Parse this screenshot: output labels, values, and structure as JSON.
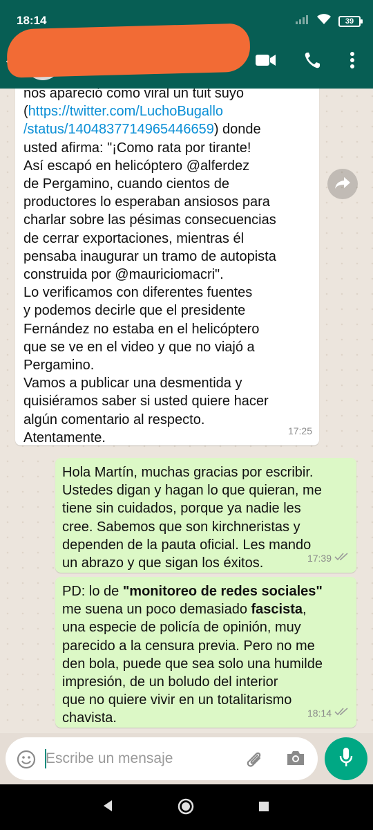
{
  "status_bar": {
    "time": "18:14",
    "battery": "39",
    "icons": [
      "signal-icon",
      "wifi-icon",
      "battery-icon"
    ]
  },
  "app_bar": {
    "contact_name": "",
    "actions": [
      "video-call-icon",
      "phone-icon",
      "more-options-icon"
    ],
    "colors": {
      "bar": "#075e54"
    }
  },
  "messages": [
    {
      "direction": "incoming",
      "time": "17:25",
      "lines": [
        "nos apareció como viral un tuit suyo",
        "(https://twitter.com/LuchoBugallo",
        "/status/1404837714965446659) donde",
        "usted afirma: \"¡Como rata por tirante!",
        "Así escapó en helicóptero @alferdez",
        "de Pergamino, cuando cientos de",
        "productores lo esperaban ansiosos para",
        "charlar sobre las pésimas consecuencias",
        "de cerrar exportaciones, mientras él",
        "pensaba inaugurar un tramo de autopista",
        "construida por @mauriciomacri\".",
        "Lo verificamos con diferentes fuentes",
        "y podemos decirle que el presidente",
        "Fernández no estaba en el helicóptero",
        "que se ve en el video y que no viajó a",
        "Pergamino.",
        "Vamos a publicar una desmentida y",
        "quisiéramos saber si usted quiere hacer",
        "algún comentario al respecto.",
        "Atentamente."
      ],
      "link_pre": "(",
      "link_l1": "https://twitter.com/LuchoBugallo",
      "link_l2": "/status/1404837714965446659",
      "link_post": ") donde"
    },
    {
      "direction": "outgoing",
      "time": "17:39",
      "lines": [
        "Hola Martín, muchas gracias por escribir.",
        "Ustedes digan y hagan lo que quieran, me",
        "tiene sin cuidados, porque ya nadie les",
        "cree. Sabemos que son kirchneristas y",
        "dependen de la pauta oficial. Les mando",
        "un abrazo y que sigan los éxitos."
      ]
    },
    {
      "direction": "outgoing",
      "time": "18:14",
      "l1_pre": "PD: lo de ",
      "l1_bold": "\"monitoreo de redes sociales\"",
      "l2_pre": "me suena un poco demasiado ",
      "l2_bold": "fascista",
      "l2_post": ",",
      "lines": [
        "una especie de policía de opinión, muy",
        "parecido a la censura previa. Pero no me",
        "den bola, puede que sea solo una humilde",
        "impresión, de un boludo del interior",
        "que no quiere vivir en un totalitarismo",
        "chavista."
      ]
    }
  ],
  "composer": {
    "placeholder": "Escribe un mensaje",
    "icons": [
      "emoji-icon",
      "attach-icon",
      "camera-icon",
      "mic-icon"
    ],
    "colors": {
      "mic": "#00a884",
      "caret": "#128c7e"
    }
  },
  "nav_bar": {
    "icons": [
      "back-triangle-icon",
      "home-circle-icon",
      "recents-square-icon"
    ]
  },
  "colors": {
    "incoming_bubble": "#ffffff",
    "outgoing_bubble": "#dcf8c6",
    "link": "#0b8fd6",
    "chat_background": "#ece5dd"
  }
}
